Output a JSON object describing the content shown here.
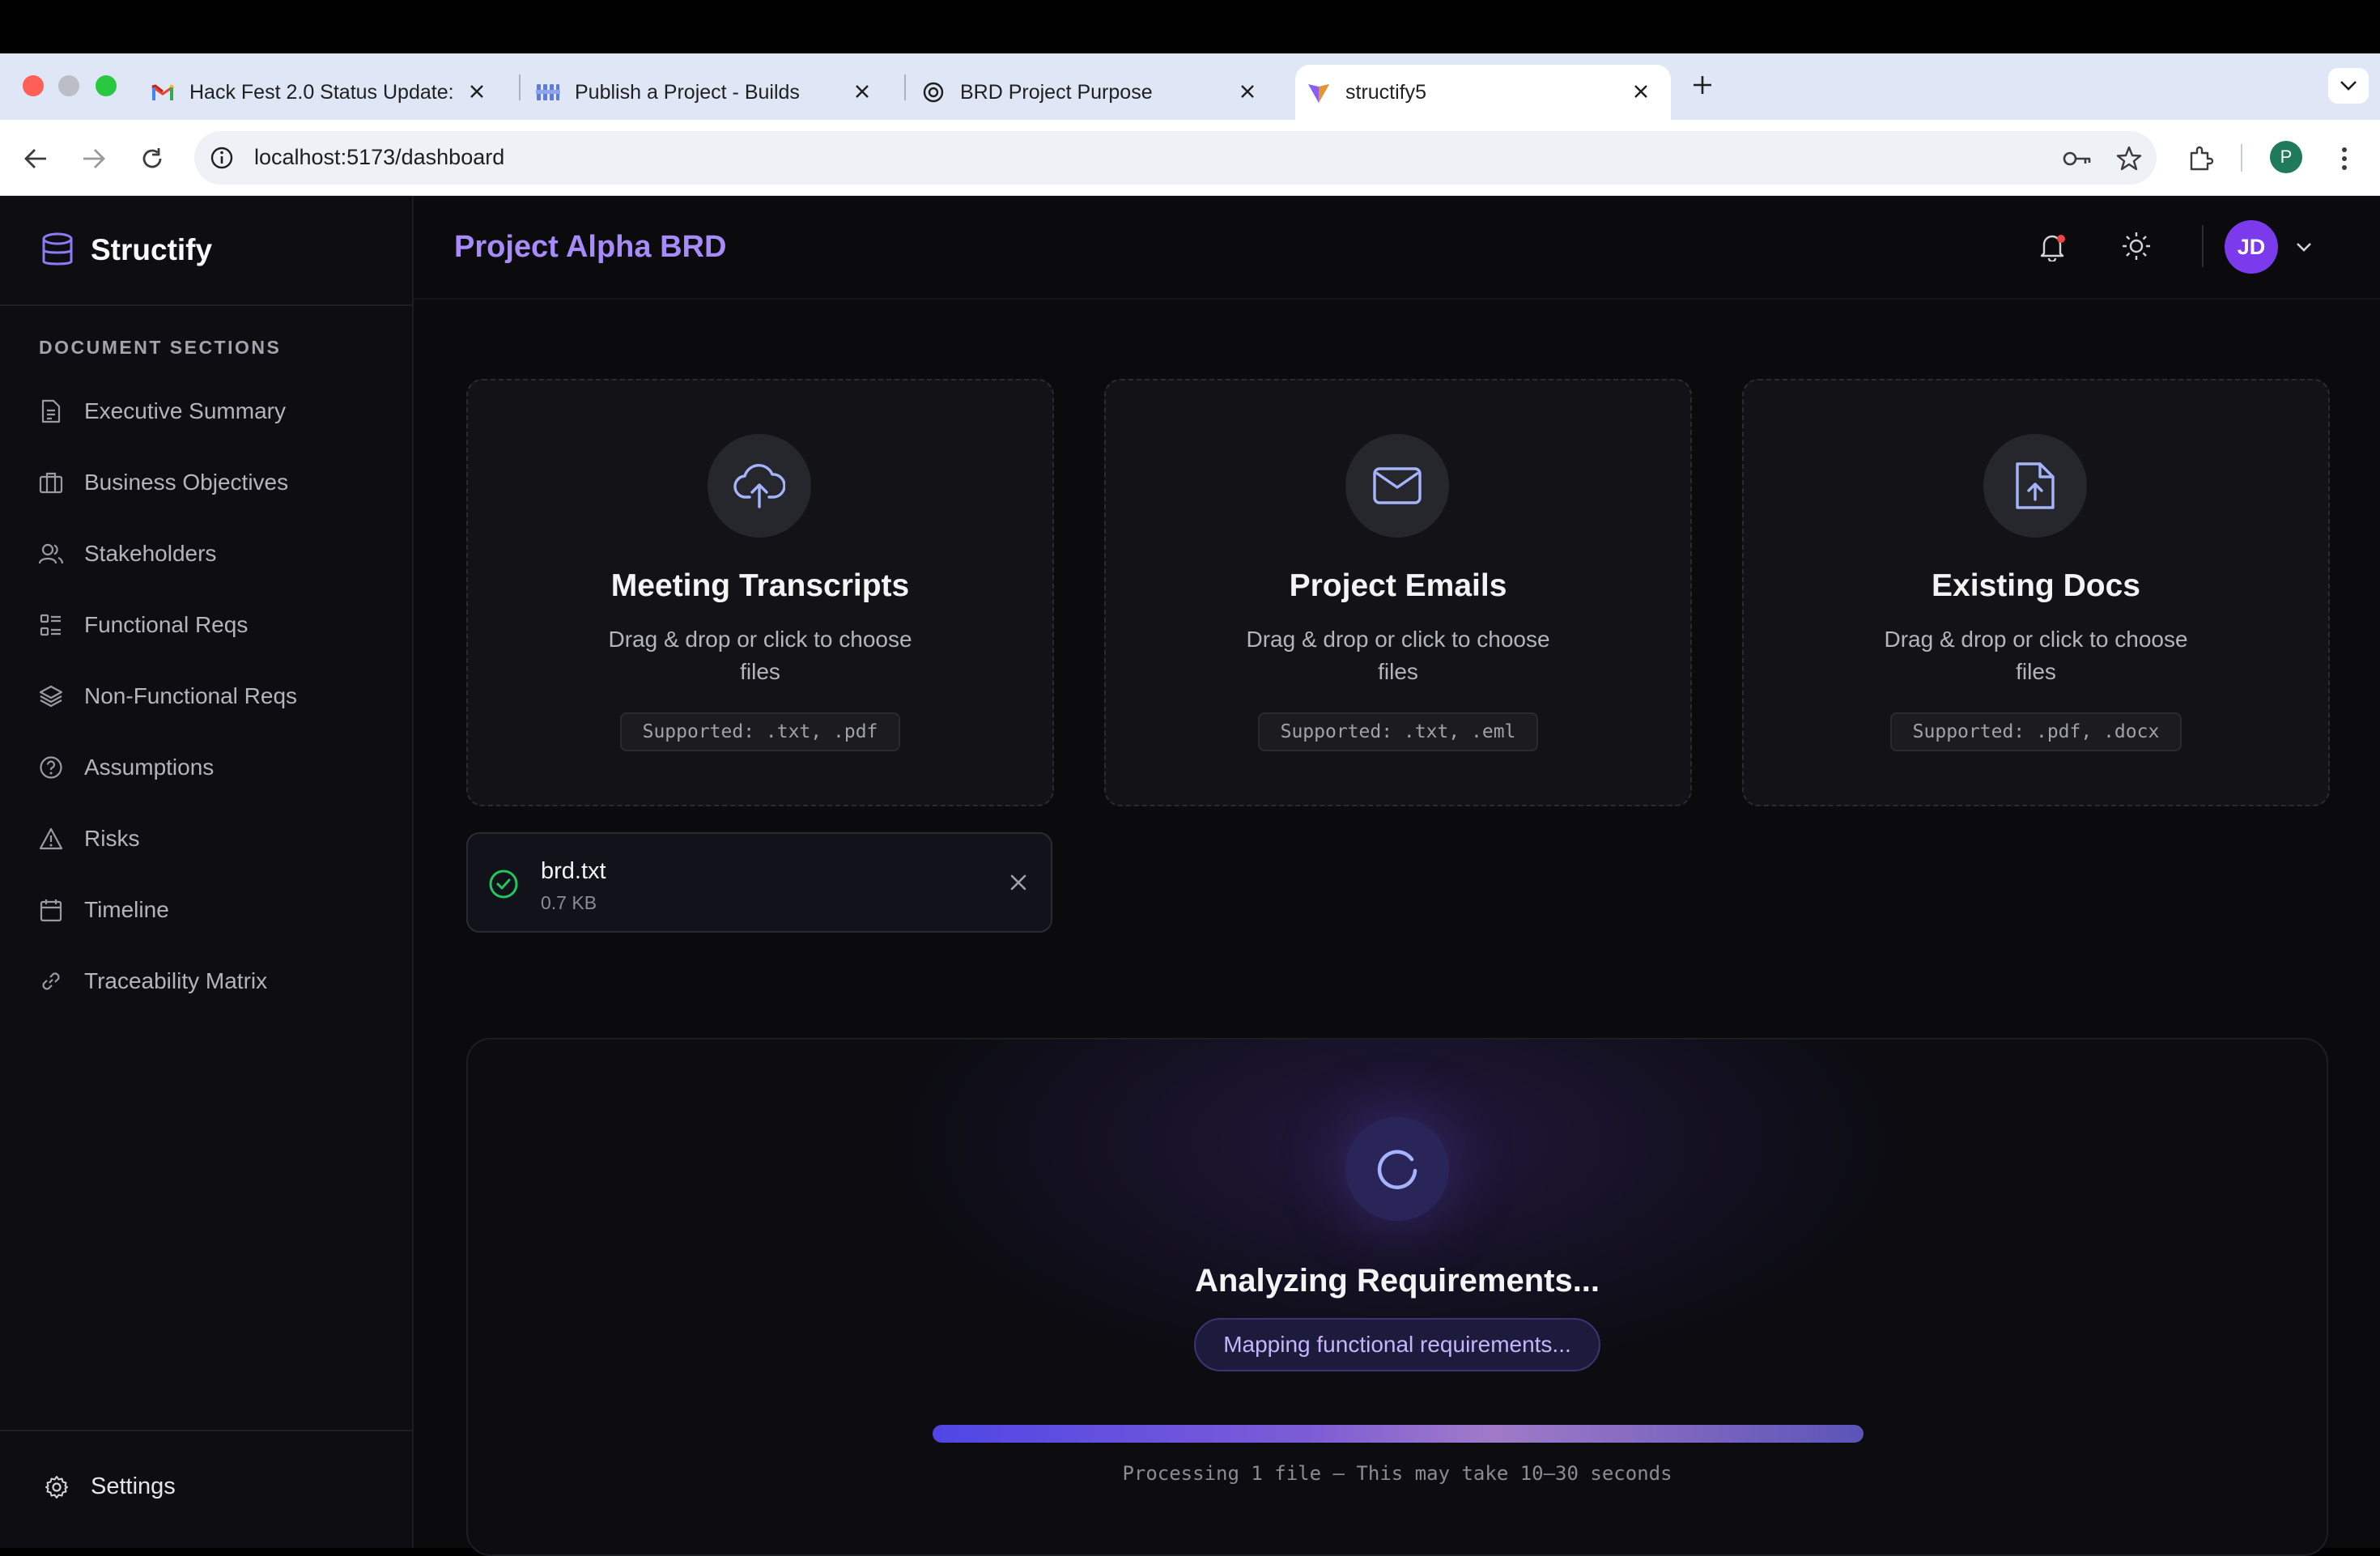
{
  "browser": {
    "tabs": [
      {
        "title": "Hack Fest 2.0 Status Update:",
        "favicon": "gmail-icon"
      },
      {
        "title": "Publish a Project - Builds",
        "favicon": "builds-icon"
      },
      {
        "title": "BRD Project Purpose",
        "favicon": "chatgpt-icon"
      },
      {
        "title": "structify5",
        "favicon": "vite-icon",
        "active": true
      }
    ],
    "url": "localhost:5173/dashboard",
    "profile_initial": "P"
  },
  "app": {
    "brand": "Structify",
    "page_title": "Project Alpha BRD",
    "user_initials": "JD",
    "colors": {
      "accent": "#a78bfa",
      "avatar": "#7c3aed",
      "success": "#22c55e"
    }
  },
  "sidebar": {
    "section_title": "DOCUMENT SECTIONS",
    "items": [
      {
        "label": "Executive Summary",
        "icon": "document-icon"
      },
      {
        "label": "Business Objectives",
        "icon": "briefcase-icon"
      },
      {
        "label": "Stakeholders",
        "icon": "users-icon"
      },
      {
        "label": "Functional Reqs",
        "icon": "list-icon"
      },
      {
        "label": "Non-Functional Reqs",
        "icon": "layers-icon"
      },
      {
        "label": "Assumptions",
        "icon": "help-circle-icon"
      },
      {
        "label": "Risks",
        "icon": "warning-icon"
      },
      {
        "label": "Timeline",
        "icon": "calendar-icon"
      },
      {
        "label": "Traceability Matrix",
        "icon": "link-icon"
      }
    ],
    "settings_label": "Settings"
  },
  "upload_cards": [
    {
      "title": "Meeting Transcripts",
      "hint": "Drag & drop or click to choose files",
      "supported": "Supported: .txt, .pdf",
      "icon": "cloud-upload-icon"
    },
    {
      "title": "Project Emails",
      "hint": "Drag & drop or click to choose files",
      "supported": "Supported: .txt, .eml",
      "icon": "mail-icon"
    },
    {
      "title": "Existing Docs",
      "hint": "Drag & drop or click to choose files",
      "supported": "Supported: .pdf, .docx",
      "icon": "file-upload-icon"
    }
  ],
  "uploaded_file": {
    "name": "brd.txt",
    "size": "0.7 KB"
  },
  "analysis": {
    "title": "Analyzing Requirements...",
    "status": "Mapping functional requirements...",
    "progress": 1.0,
    "note": "Processing 1 file — This may take 10–30 seconds"
  }
}
